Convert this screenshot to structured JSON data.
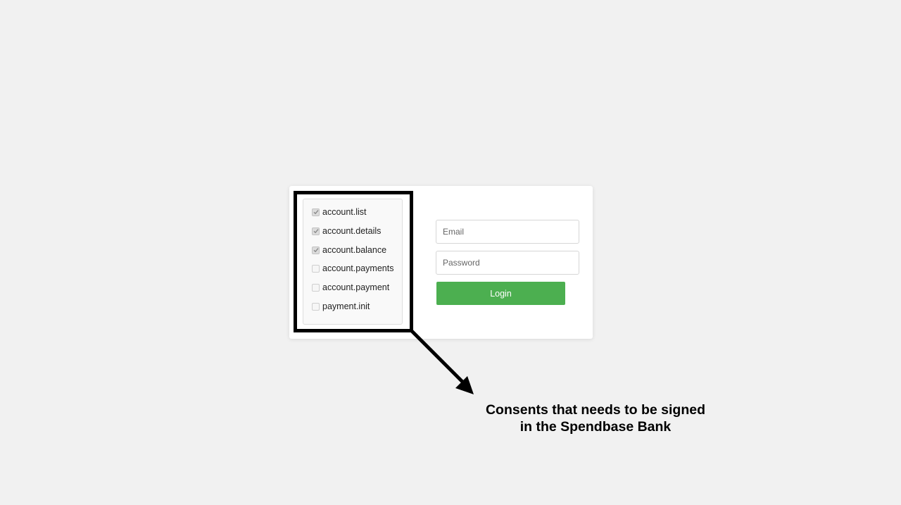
{
  "consents": [
    {
      "label": "account.list",
      "checked": true
    },
    {
      "label": "account.details",
      "checked": true
    },
    {
      "label": "account.balance",
      "checked": true
    },
    {
      "label": "account.payments",
      "checked": false
    },
    {
      "label": "account.payment",
      "checked": false
    },
    {
      "label": "payment.init",
      "checked": false
    }
  ],
  "login": {
    "email_placeholder": "Email",
    "password_placeholder": "Password",
    "button_label": "Login"
  },
  "annotation": {
    "line1": "Consents that needs to be signed",
    "line2": "in the Spendbase Bank"
  },
  "colors": {
    "background": "#f1f1f1",
    "login_button": "#4caf50",
    "highlight": "#000000"
  }
}
